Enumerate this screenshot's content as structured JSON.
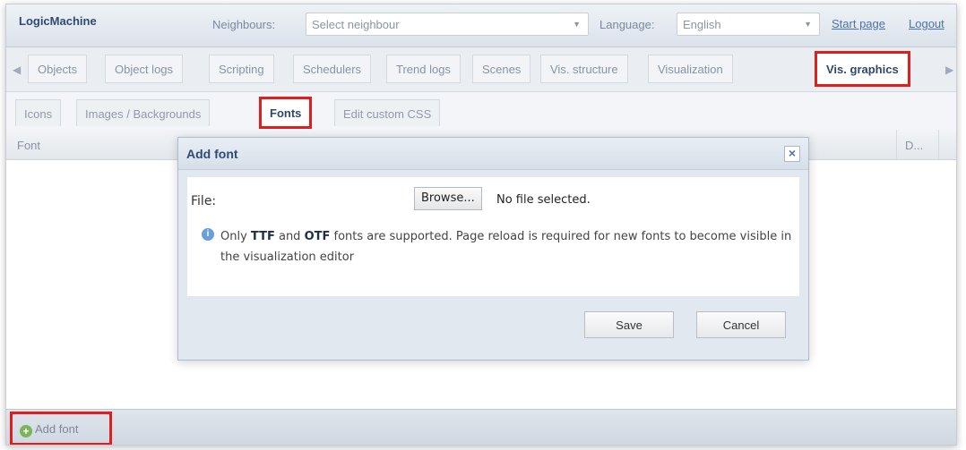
{
  "header": {
    "brand": "LogicMachine",
    "neighbours_label": "Neighbours:",
    "neighbours_value": "Select neighbour",
    "language_label": "Language:",
    "language_value": "English",
    "start_page": "Start page",
    "logout": "Logout"
  },
  "tabs": [
    {
      "label": "Objects"
    },
    {
      "label": "Object logs"
    },
    {
      "label": "Scripting"
    },
    {
      "label": "Schedulers"
    },
    {
      "label": "Trend logs"
    },
    {
      "label": "Scenes"
    },
    {
      "label": "Vis. structure"
    },
    {
      "label": "Visualization"
    },
    {
      "label": "Vis. graphics",
      "active": true
    }
  ],
  "subtabs": [
    {
      "label": "Icons"
    },
    {
      "label": "Images / Backgrounds"
    },
    {
      "label": "Fonts",
      "active": true
    },
    {
      "label": "Edit custom CSS"
    }
  ],
  "grid": {
    "col_font": "Font",
    "col_d": "D..."
  },
  "footer": {
    "add_font": "Add font"
  },
  "dialog": {
    "title": "Add font",
    "file_label": "File:",
    "browse": "Browse...",
    "no_file": "No file selected.",
    "info_pre": "Only ",
    "info_ttf": "TTF",
    "info_and": " and ",
    "info_otf": "OTF",
    "info_post": " fonts are supported. Page reload is required for new fonts to become visible in the visualization editor",
    "save": "Save",
    "cancel": "Cancel"
  },
  "colors": {
    "highlight": "#e01e1e",
    "brand": "#2e4b74",
    "link": "#4a74a8"
  }
}
